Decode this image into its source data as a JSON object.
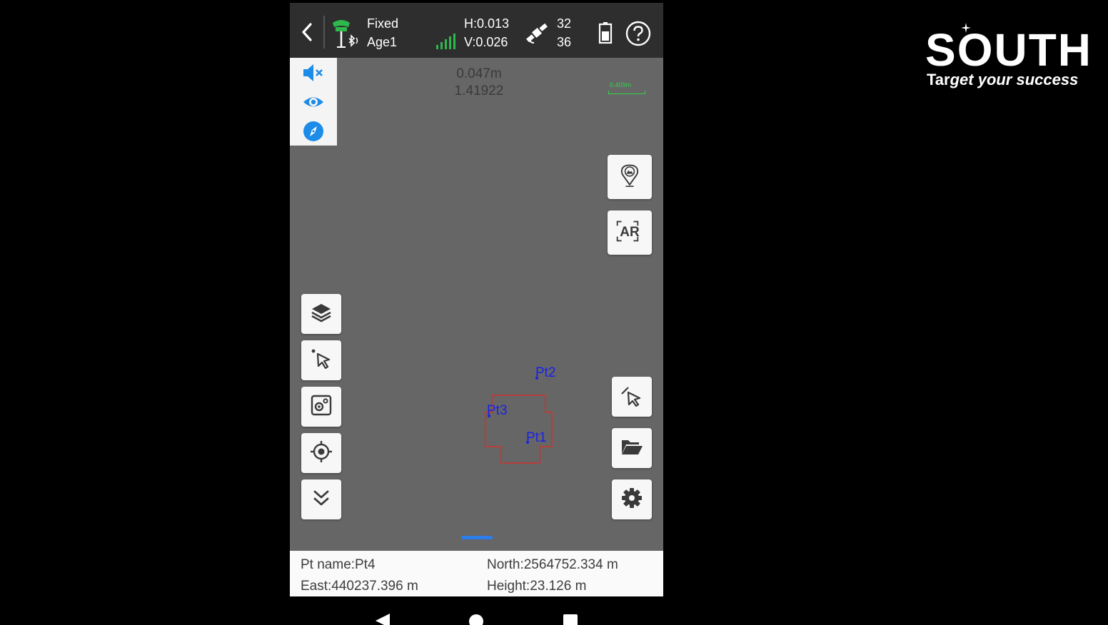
{
  "status_bar": {
    "fix_status": "Fixed",
    "age": "Age1",
    "h_precision": "H:0.013",
    "v_precision": "V:0.026",
    "sats_used": "32",
    "sats_tracked": "36"
  },
  "map": {
    "measure_distance": "0.047m",
    "measure_ratio": "1.41922",
    "scale_label": "0.409m",
    "points": [
      "Pt2",
      "Pt3",
      "Pt1"
    ],
    "ar_label": "AR"
  },
  "info_panel": {
    "pt_name": "Pt name:Pt4",
    "north": "North:2564752.334 m",
    "east": "East:440237.396 m",
    "height": "Height:23.126 m"
  },
  "logo": {
    "brand": "SOUTH",
    "tagline_bold": "Tar",
    "tagline_rest": "get your success"
  },
  "colors": {
    "map_bg": "#666666",
    "status_bg": "#2e2e2e",
    "accent_blue": "#2b7de9",
    "point_blue": "#1a22e6",
    "polygon_red": "#d0312d",
    "signal_green": "#35d24a"
  }
}
